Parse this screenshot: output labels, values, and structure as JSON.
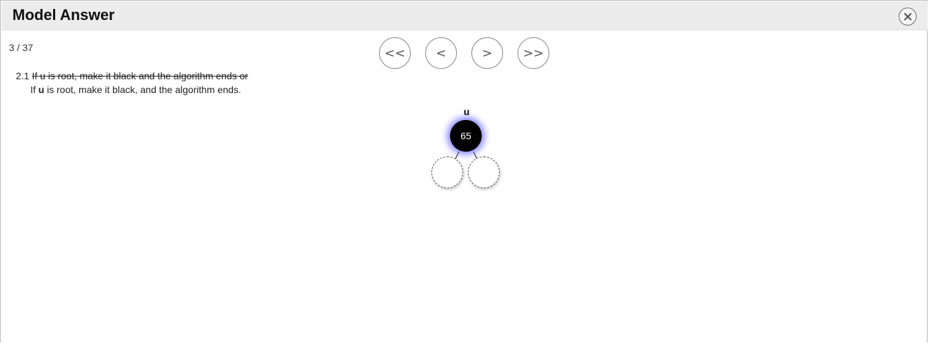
{
  "window": {
    "title": "Model Answer",
    "close_icon": "close-icon"
  },
  "progress": {
    "counter": "3 / 37"
  },
  "nav": {
    "first_label": "<<",
    "prev_label": "<",
    "next_label": ">",
    "last_label": ">>"
  },
  "step": {
    "number": "2.1",
    "struck_text": "If u is root, make it black and the algorithm ends or",
    "line2_prefix": "If ",
    "line2_bold": "u",
    "line2_suffix": " is root, make it black, and the algorithm ends."
  },
  "tree": {
    "root": {
      "label": "u",
      "value": "65",
      "color": "#000000",
      "highlight": "#5a5aff"
    },
    "leaves": [
      "",
      ""
    ]
  }
}
